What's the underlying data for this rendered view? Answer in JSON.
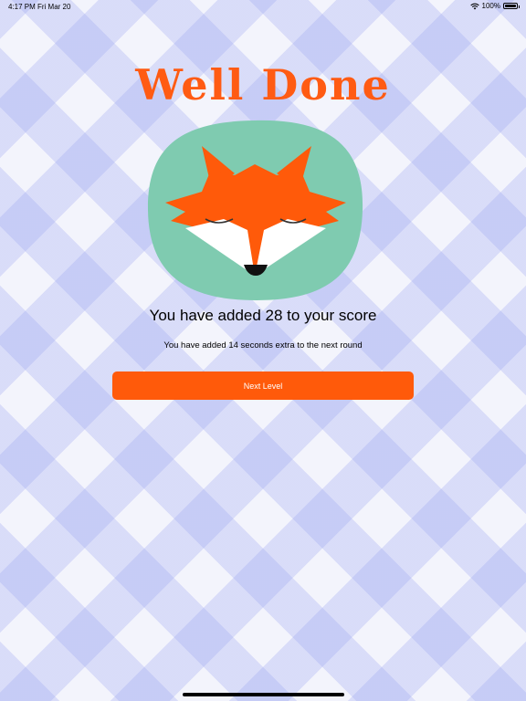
{
  "status": {
    "time": "4:17 PM",
    "date": "Fri Mar 20",
    "battery": "100%"
  },
  "title": "Well Done",
  "score_message": "You have added 28 to your score",
  "bonus_message": "You have added 14 seconds extra to the next round",
  "next_button_label": "Next Level",
  "colors": {
    "accent": "#ff5a0a",
    "fox_background": "#7fcbb0"
  }
}
